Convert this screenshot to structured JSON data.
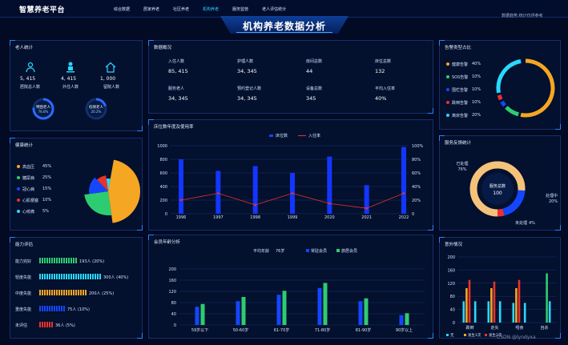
{
  "header": {
    "brand": "智慧养老平台",
    "nav": [
      "综合数据",
      "居家养老",
      "社区养老",
      "机构养老",
      "服务监管",
      "老人评估统计"
    ],
    "active_index": 3,
    "title": "机构养老数据分析",
    "right_text": "数据趋势,统计仅供参考"
  },
  "elder_stats": {
    "title": "老人统计",
    "items": [
      {
        "icon": "group-icon",
        "value": "5, 415",
        "label": "居院总人数"
      },
      {
        "icon": "person-icon",
        "value": "4, 415",
        "label": "外住人数"
      },
      {
        "icon": "house-icon",
        "value": "1, 000",
        "label": "留院人数"
      }
    ],
    "rings": [
      {
        "label": "特困老人",
        "value": "76.6%",
        "pct": 0.766
      },
      {
        "label": "低保老人",
        "value": "20.2%",
        "pct": 0.202
      }
    ]
  },
  "overview": {
    "title": "数据概况",
    "cells": [
      {
        "label": "入住人数",
        "value": "85, 415"
      },
      {
        "label": "护理人数",
        "value": "34, 345"
      },
      {
        "label": "房间总数",
        "value": "44"
      },
      {
        "label": "床位总数",
        "value": "132"
      },
      {
        "label": "服务老人",
        "value": "34, 345"
      },
      {
        "label": "预约登记人数",
        "value": "34, 345"
      },
      {
        "label": "设备总数",
        "value": "345"
      },
      {
        "label": "平均入住率",
        "value": "40%"
      }
    ]
  },
  "device_types": {
    "title": "告警类型占比",
    "items": [
      {
        "label": "健康告警",
        "pct": "40%",
        "color": "#f5a623"
      },
      {
        "label": "SOS告警",
        "pct": "10%",
        "color": "#2ecc71"
      },
      {
        "label": "围栏告警",
        "pct": "10%",
        "color": "#1446ff"
      },
      {
        "label": "跌倒告警",
        "pct": "10%",
        "color": "#e8322c"
      },
      {
        "label": "离床告警",
        "pct": "20%",
        "color": "#29d8ff"
      }
    ],
    "ring_colors": [
      "#f5a623",
      "#2ecc71",
      "#1446ff",
      "#e8322c",
      "#29d8ff"
    ]
  },
  "health": {
    "title": "健康统计",
    "items": [
      {
        "label": "高血压",
        "pct": "45%",
        "color": "#f5a623"
      },
      {
        "label": "糖尿病",
        "pct": "25%",
        "color": "#2ecc71"
      },
      {
        "label": "冠心病",
        "pct": "15%",
        "color": "#1446ff"
      },
      {
        "label": "心肌梗塞",
        "pct": "10%",
        "color": "#e8322c"
      },
      {
        "label": "心绞痛",
        "pct": "5%",
        "color": "#29d8ff"
      }
    ]
  },
  "bed_chart": {
    "title": "床位数年度及使用率",
    "legend": [
      "床位数",
      "入住率"
    ]
  },
  "feedback": {
    "title": "服务反馈统计",
    "center_label": "服务总数",
    "center_value": "100",
    "labels": [
      {
        "text": "已处理",
        "value": "76%"
      },
      {
        "text": "处理中",
        "value": "20%"
      },
      {
        "text": "未处理",
        "value": "4%"
      }
    ]
  },
  "ability": {
    "title": "能力评估",
    "rows": [
      {
        "label": "能力完好",
        "value": "193人 (20%)",
        "color": "#2ecc71",
        "n": 16
      },
      {
        "label": "轻度失能",
        "value": "300人 (40%)",
        "color": "#29d8ff",
        "n": 26
      },
      {
        "label": "中度失能",
        "value": "200人 (25%)",
        "color": "#f5a623",
        "n": 20
      },
      {
        "label": "重度失能",
        "value": "75人 (10%)",
        "color": "#1446ff",
        "n": 11
      },
      {
        "label": "未评估",
        "value": "36人 (5%)",
        "color": "#e8322c",
        "n": 6
      }
    ]
  },
  "age_chart": {
    "title": "会员年龄分析",
    "avg_label": "平均年龄",
    "avg_value": "76岁",
    "legend": [
      "常驻会员",
      "旅居会员"
    ]
  },
  "incident": {
    "title": "意外情况"
  },
  "watermark": "CSDN @lyndyxa",
  "chart_data": [
    {
      "type": "bar",
      "title": "床位数年度及使用率",
      "categories": [
        "1996",
        "1997",
        "1998",
        "1999",
        "2020",
        "2021",
        "2022"
      ],
      "series": [
        {
          "name": "床位数",
          "type": "bar",
          "values": [
            800,
            630,
            700,
            600,
            840,
            420,
            980
          ]
        },
        {
          "name": "入住率",
          "type": "line",
          "values": [
            20,
            30,
            13,
            30,
            15,
            8,
            30
          ]
        }
      ],
      "ylim": [
        0,
        1000
      ],
      "y2lim": [
        0,
        100
      ],
      "yticks": [
        "0",
        "200",
        "400",
        "600",
        "800",
        "1000"
      ],
      "y2ticks": [
        "0",
        "20%",
        "40%",
        "60%",
        "80%",
        "100%"
      ]
    },
    {
      "type": "bar",
      "title": "会员年龄分析",
      "categories": [
        "59岁以下",
        "50-60岁",
        "61-70岁",
        "71-80岁",
        "81-90岁",
        "90岁以上"
      ],
      "series": [
        {
          "name": "常驻会员",
          "values": [
            65,
            85,
            108,
            132,
            85,
            35
          ]
        },
        {
          "name": "旅居会员",
          "values": [
            75,
            100,
            122,
            150,
            95,
            42
          ]
        }
      ],
      "ylim": [
        0,
        200
      ],
      "yticks": [
        "0",
        "40",
        "80",
        "120",
        "160",
        "200"
      ]
    },
    {
      "type": "bar",
      "title": "意外情况",
      "categories": [
        "跌倒",
        "走失",
        "噎食",
        "自杀"
      ],
      "series": [
        {
          "values": [
            65,
            65,
            60,
            0
          ]
        },
        {
          "values": [
            105,
            105,
            105,
            0
          ]
        },
        {
          "values": [
            130,
            125,
            130,
            0
          ]
        },
        {
          "values": [
            0,
            0,
            0,
            150
          ]
        },
        {
          "values": [
            65,
            65,
            60,
            65
          ]
        }
      ],
      "colors": [
        "#29d8ff",
        "#f5a623",
        "#e8322c",
        "#2ecc71",
        "#29d8ff"
      ],
      "ylim": [
        0,
        200
      ],
      "yticks": [
        "0",
        "40",
        "80",
        "120",
        "160",
        "200"
      ],
      "legend": [
        "无",
        "发生1次",
        "发生2次"
      ]
    },
    {
      "type": "pie",
      "title": "健康统计",
      "labels": [
        "高血压",
        "糖尿病",
        "冠心病",
        "心肌梗塞",
        "心绞痛"
      ],
      "values": [
        45,
        25,
        15,
        10,
        5
      ]
    },
    {
      "type": "pie",
      "title": "服务反馈统计",
      "labels": [
        "已处理",
        "处理中",
        "未处理"
      ],
      "values": [
        76,
        20,
        4
      ]
    }
  ]
}
